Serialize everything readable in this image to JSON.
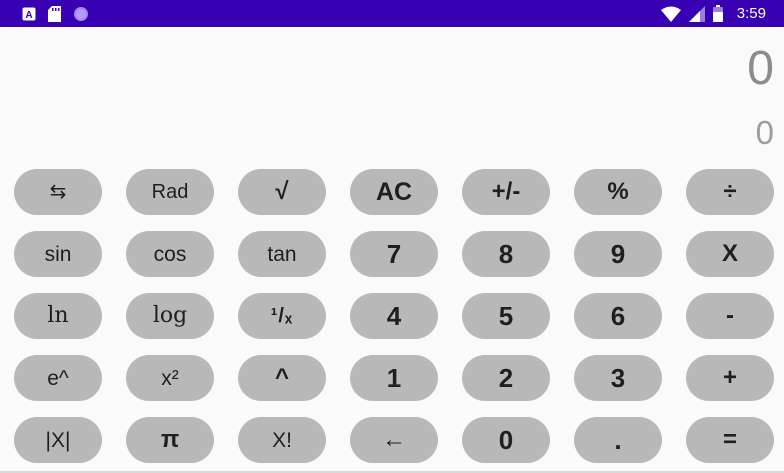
{
  "status_bar": {
    "time": "3:59",
    "left_icons": [
      "notification-a-icon",
      "sd-card-icon",
      "circle-dot-icon"
    ],
    "right_icons": [
      "wifi-icon",
      "signal-icon",
      "battery-icon"
    ]
  },
  "display": {
    "main_value": "0",
    "secondary_value": "0"
  },
  "keys": {
    "row1": [
      "⇆",
      "Rad",
      "√",
      "AC",
      "+/-",
      "%",
      "÷"
    ],
    "row2": [
      "sin",
      "cos",
      "tan",
      "7",
      "8",
      "9",
      "X"
    ],
    "row3": [
      "ln",
      "log",
      "¹/ₓ",
      "4",
      "5",
      "6",
      "-"
    ],
    "row4": [
      "e^",
      "x²",
      "^",
      "1",
      "2",
      "3",
      "+"
    ],
    "row5": [
      "|X|",
      "π",
      "X!",
      "←",
      "0",
      ".",
      "="
    ]
  },
  "colors": {
    "status_bar": "#3700b3",
    "key_background": "#b8b8b8",
    "display_text": "#8c8c8c"
  }
}
